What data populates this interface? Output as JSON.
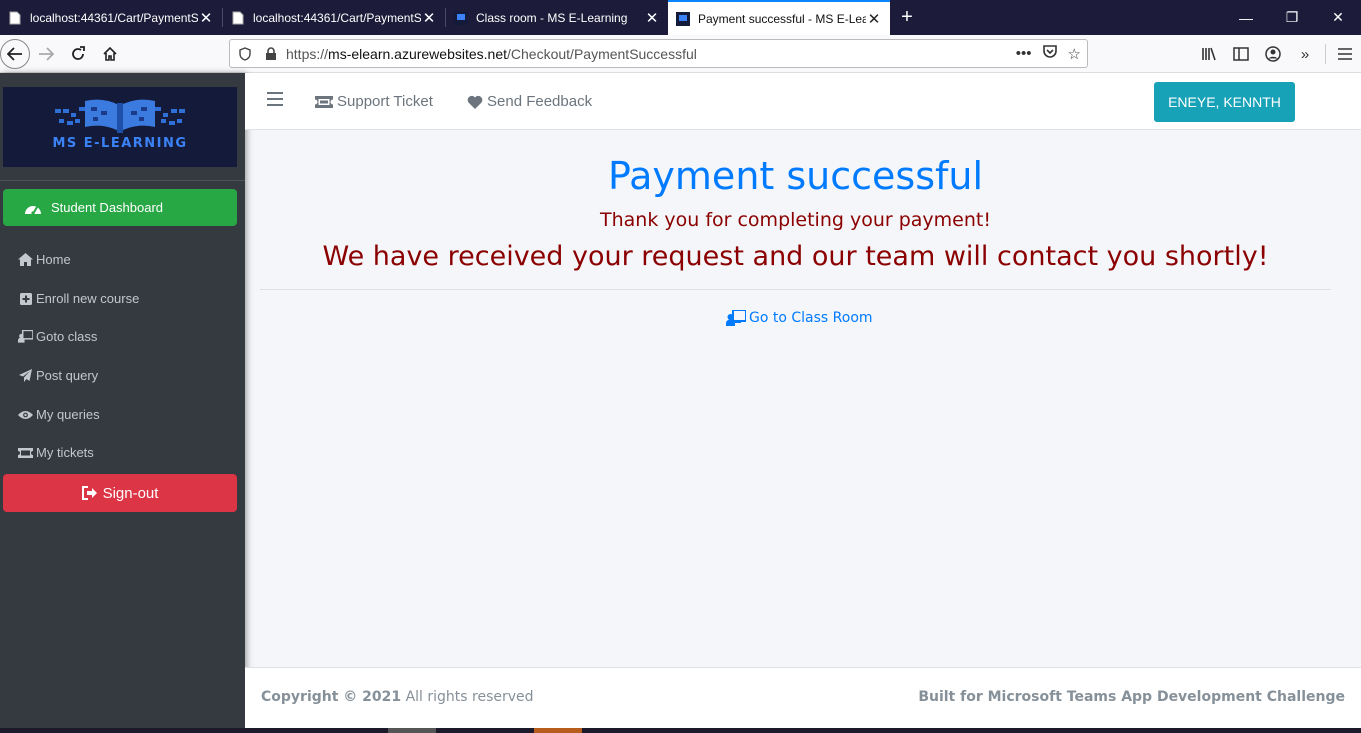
{
  "browser": {
    "tabs": [
      {
        "title": "localhost:44361/Cart/PaymentS",
        "active": false,
        "icon": "page-icon"
      },
      {
        "title": "localhost:44361/Cart/PaymentS",
        "active": false,
        "icon": "page-icon"
      },
      {
        "title": "Class room - MS E-Learning",
        "active": false,
        "icon": "ms-elearning-favicon"
      },
      {
        "title": "Payment successful - MS E-Lea",
        "active": true,
        "icon": "ms-elearning-favicon"
      }
    ],
    "url_prefix": "https://",
    "url_host": "ms-elearn.azurewebsites.net",
    "url_path": "/Checkout/PaymentSuccessful"
  },
  "sidebar": {
    "brand_text": "MS E-LEARNING",
    "dashboard_label": "Student Dashboard",
    "items": [
      {
        "label": "Home",
        "icon": "home-icon"
      },
      {
        "label": "Enroll new course",
        "icon": "plus-square-icon"
      },
      {
        "label": "Goto class",
        "icon": "chalkboard-teacher-icon"
      },
      {
        "label": "Post query",
        "icon": "paper-plane-icon"
      },
      {
        "label": "My queries",
        "icon": "eye-icon"
      },
      {
        "label": "My tickets",
        "icon": "ticket-icon"
      }
    ],
    "signout_label": "Sign-out"
  },
  "header": {
    "support_label": "Support Ticket",
    "feedback_label": "Send Feedback",
    "user_name": "ENEYE, KENNTH"
  },
  "main": {
    "title": "Payment successful",
    "subtitle": "Thank you for completing your payment!",
    "message": "We have received your request and our team will contact you shortly!",
    "classroom_link": "Go to Class Room"
  },
  "footer": {
    "copyright_bold": "Copyright © 2021",
    "copyright_rest": " All rights reserved",
    "built_for": "Built for Microsoft Teams App Development Challenge"
  },
  "colors": {
    "primary": "#007bff",
    "success": "#28a745",
    "danger": "#dc3545",
    "info": "#17a2b8",
    "message_red": "#8b0000",
    "sidebar_bg": "#343a40"
  }
}
